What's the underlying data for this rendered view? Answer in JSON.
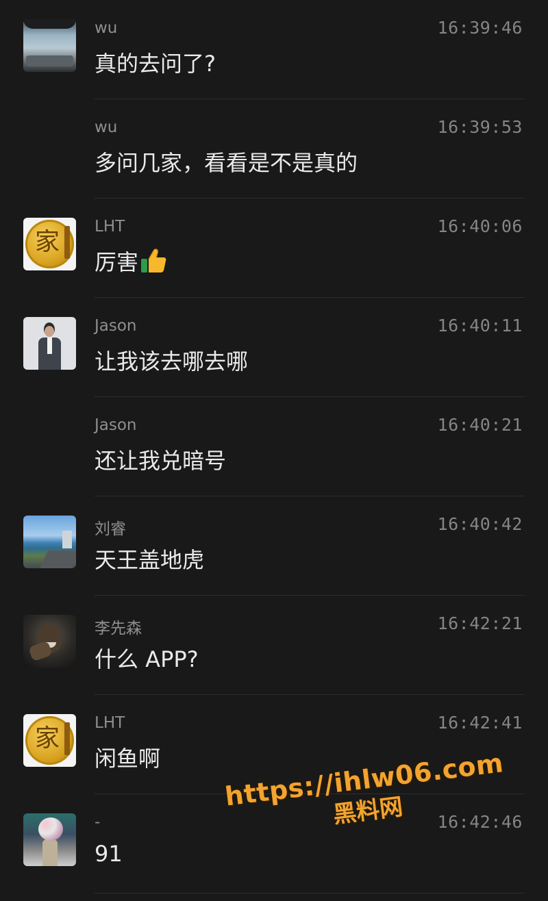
{
  "messages": [
    {
      "name": "wu",
      "time": "16:39:46",
      "text": "真的去问了?",
      "avatar": "car-windshield"
    },
    {
      "name": "wu",
      "time": "16:39:53",
      "text": "多问几家，看看是不是真的",
      "avatar": null
    },
    {
      "name": "LHT",
      "time": "16:40:06",
      "text": "厉害",
      "emoji": "👍",
      "avatar": "gold-coin",
      "avatar_char": "家"
    },
    {
      "name": "Jason",
      "time": "16:40:11",
      "text": "让我该去哪去哪",
      "avatar": "man-in-suit"
    },
    {
      "name": "Jason",
      "time": "16:40:21",
      "text": "还让我兑暗号",
      "avatar": null
    },
    {
      "name": "刘睿",
      "time": "16:40:42",
      "text": "天王盖地虎",
      "avatar": "coastline"
    },
    {
      "name": "李先森",
      "time": "16:42:21",
      "text": "什么 APP?",
      "avatar": "dark-portrait"
    },
    {
      "name": "LHT",
      "time": "16:42:41",
      "text": "闲鱼啊",
      "avatar": "gold-coin",
      "avatar_char": "家"
    },
    {
      "name": "-",
      "time": "16:42:46",
      "text": "91",
      "avatar": "crowd-flowers"
    }
  ],
  "watermark": {
    "url": "https://ihlw06.com",
    "site": "黑料网",
    "color": "#f2a330"
  },
  "colors": {
    "background": "#191919",
    "name": "#8f8f8f",
    "time": "#858585",
    "text": "#eaeaea",
    "divider": "#2d2d2d"
  }
}
